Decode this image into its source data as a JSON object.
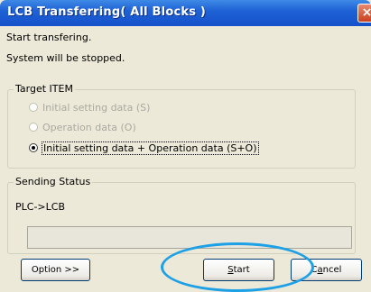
{
  "window": {
    "title": "LCB Transferring( All Blocks )",
    "close_glyph": "×"
  },
  "messages": {
    "line1": "Start transfering.",
    "line2": "System will be stopped."
  },
  "target_item": {
    "title": "Target ITEM",
    "options": [
      {
        "label": "Initial setting data (S)",
        "selected": false,
        "enabled": false
      },
      {
        "label": "Operation data (O)",
        "selected": false,
        "enabled": false
      },
      {
        "label": "Initial setting data + Operation data (S+O)",
        "selected": true,
        "enabled": true
      }
    ]
  },
  "sending_status": {
    "title": "Sending Status",
    "text": "PLC->LCB",
    "progress": 0
  },
  "buttons": {
    "option": "Option >>",
    "start": "Start",
    "cancel": "Cancel"
  },
  "colors": {
    "titlebar": "#1f62d6",
    "highlight": "#1ea0e6"
  }
}
